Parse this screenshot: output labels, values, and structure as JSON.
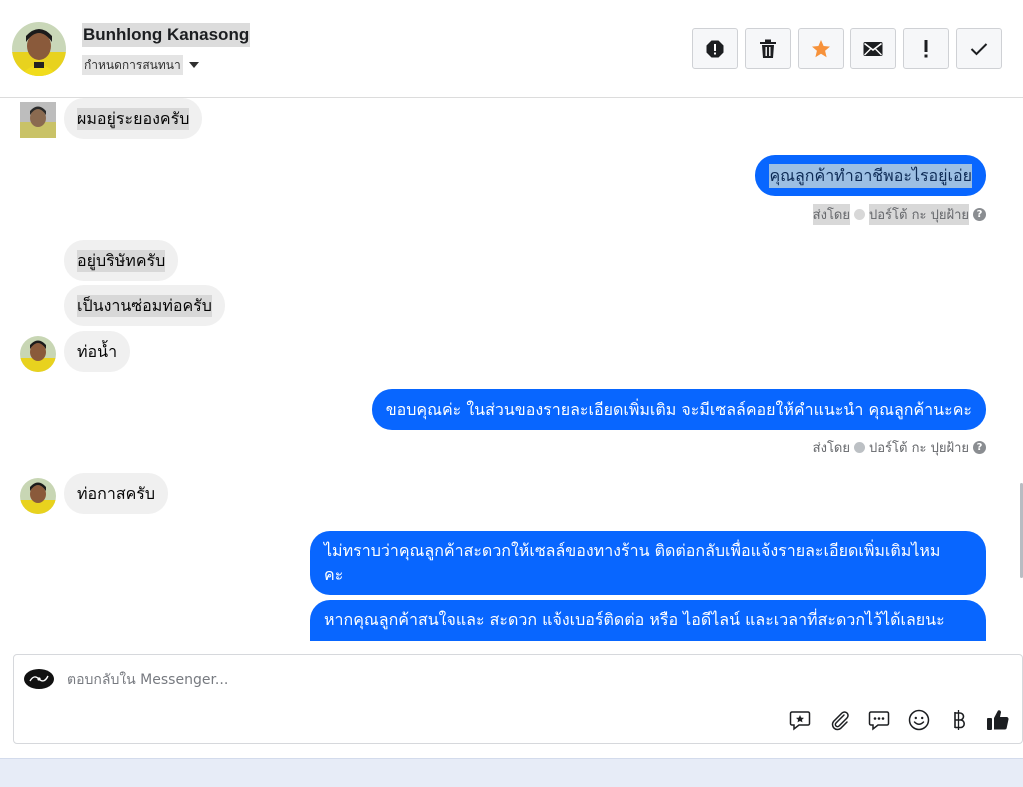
{
  "header": {
    "contact_name": "Bunhlong Kanasong",
    "assign_label": "กำหนดการสนทนา"
  },
  "toolbar": {
    "buttons": [
      "spam-icon",
      "trash-icon",
      "star-icon",
      "envelope-icon",
      "exclamation-icon",
      "checkmark-icon"
    ],
    "star_color": "#f7923b"
  },
  "messages": [
    {
      "from": "customer",
      "text": "ผมอยู่ระยองครับ"
    },
    {
      "from": "page",
      "text": "คุณลูกค้าทำอาชีพอะไรอยู่เอ่ย",
      "sent_by_label": "ส่งโดย",
      "sender": "ปอร์โต้ กะ ปุยฝ้าย"
    },
    {
      "from": "customer",
      "text": "อยู่บริษัทครับ"
    },
    {
      "from": "customer",
      "text": "เป็นงานซ่อมท่อครับ"
    },
    {
      "from": "customer",
      "text": "ท่อน้ำ"
    },
    {
      "from": "page",
      "text": "ขอบคุณค่ะ  ในส่วนของรายละเอียดเพิ่มเติม จะมีเซลล์คอยให้คำแนะนำ คุณลูกค้านะคะ",
      "sent_by_label": "ส่งโดย",
      "sender": "ปอร์โต้ กะ ปุยฝ้าย"
    },
    {
      "from": "customer",
      "text": "ท่อกาสครับ"
    },
    {
      "from": "page",
      "line1": "ไม่ทราบว่าคุณลูกค้าสะดวกให้เซลล์ของทางร้าน ติดต่อกลับเพื่อแจ้งรายละเอียดเพิ่มเติมไหม",
      "line2": "คะ"
    },
    {
      "from": "page",
      "text": "หากคุณลูกค้าสนใจและ สะดวก แจ้งเบอร์ติดต่อ หรือ ไอดีไลน์ และเวลาที่สะดวกไว้ได้เลยนะ"
    }
  ],
  "composer": {
    "placeholder": "ตอบกลับใน Messenger...",
    "icons": [
      "saved-reply-icon",
      "attachment-icon",
      "chat-bubbles-icon",
      "emoji-icon",
      "baht-payment-icon",
      "thumbs-up-icon"
    ]
  },
  "colors": {
    "brand_blue": "#0866ff",
    "incoming_bubble": "#f0f0f0"
  }
}
